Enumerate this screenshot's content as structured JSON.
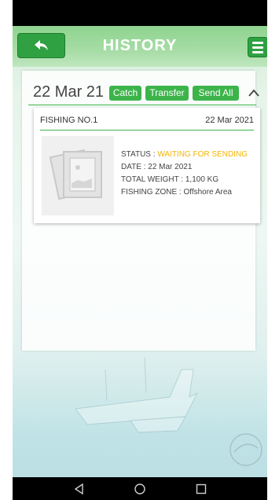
{
  "header": {
    "title": "HISTORY",
    "back_icon": "reply-arrow-icon",
    "menu_icon": "hamburger-menu-icon"
  },
  "group": {
    "date": "22 Mar 21",
    "buttons": [
      "Catch",
      "Transfer",
      "Send All"
    ],
    "toggle_icon": "chevron-up-icon"
  },
  "card": {
    "name": "FISHING NO.1",
    "date": "22 Mar 2021",
    "thumbnail_icon": "image-placeholder-icon",
    "status_label": "STATUS : ",
    "status_value": "WAITING FOR SENDING",
    "date_line": "DATE : 22 Mar 2021",
    "weight_line": "TOTAL WEIGHT : 1,100 KG",
    "zone_line": "FISHING ZONE : Offshore Area"
  },
  "navbar": {
    "back_icon": "nav-back-triangle-icon",
    "home_icon": "nav-home-circle-icon",
    "recents_icon": "nav-recents-square-icon"
  },
  "colors": {
    "accent_green": "#3cb44a",
    "status_yellow": "#f5b400"
  }
}
